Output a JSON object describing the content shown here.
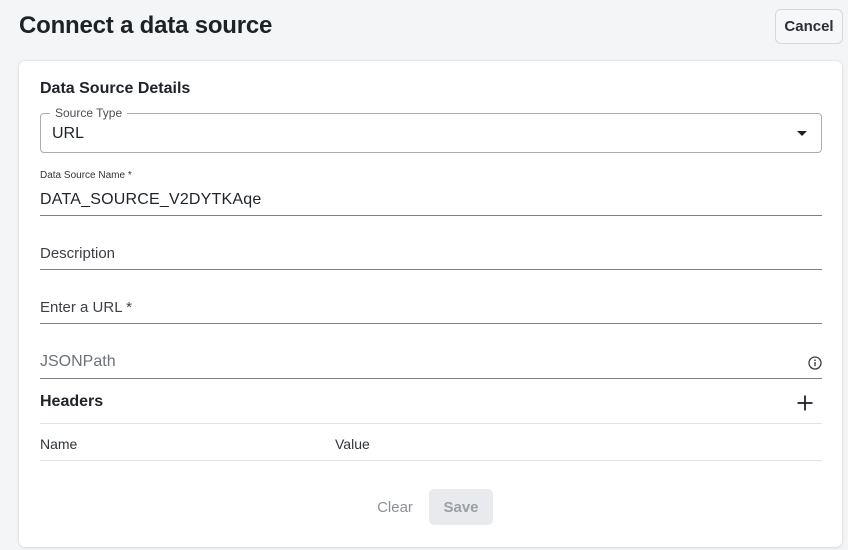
{
  "page": {
    "title": "Connect a data source",
    "cancel_label": "Cancel"
  },
  "form": {
    "section_title": "Data Source Details",
    "source_type": {
      "label": "Source Type",
      "value": "URL"
    },
    "data_source_name": {
      "label": "Data Source Name *",
      "value": "DATA_SOURCE_V2DYTKAqe"
    },
    "description": {
      "label": "Description"
    },
    "url": {
      "label": "Enter a URL *"
    },
    "jsonpath": {
      "placeholder": "JSONPath",
      "icon": "info-icon"
    },
    "headers": {
      "title": "Headers",
      "add_icon": "plus-icon",
      "columns": [
        "Name",
        "Value"
      ]
    },
    "actions": {
      "clear_label": "Clear",
      "save_label": "Save"
    }
  },
  "colors": {
    "background": "#f4f5f6",
    "card": "#ffffff",
    "text": "#1f2329",
    "disabled_button": "#e8eaed"
  }
}
